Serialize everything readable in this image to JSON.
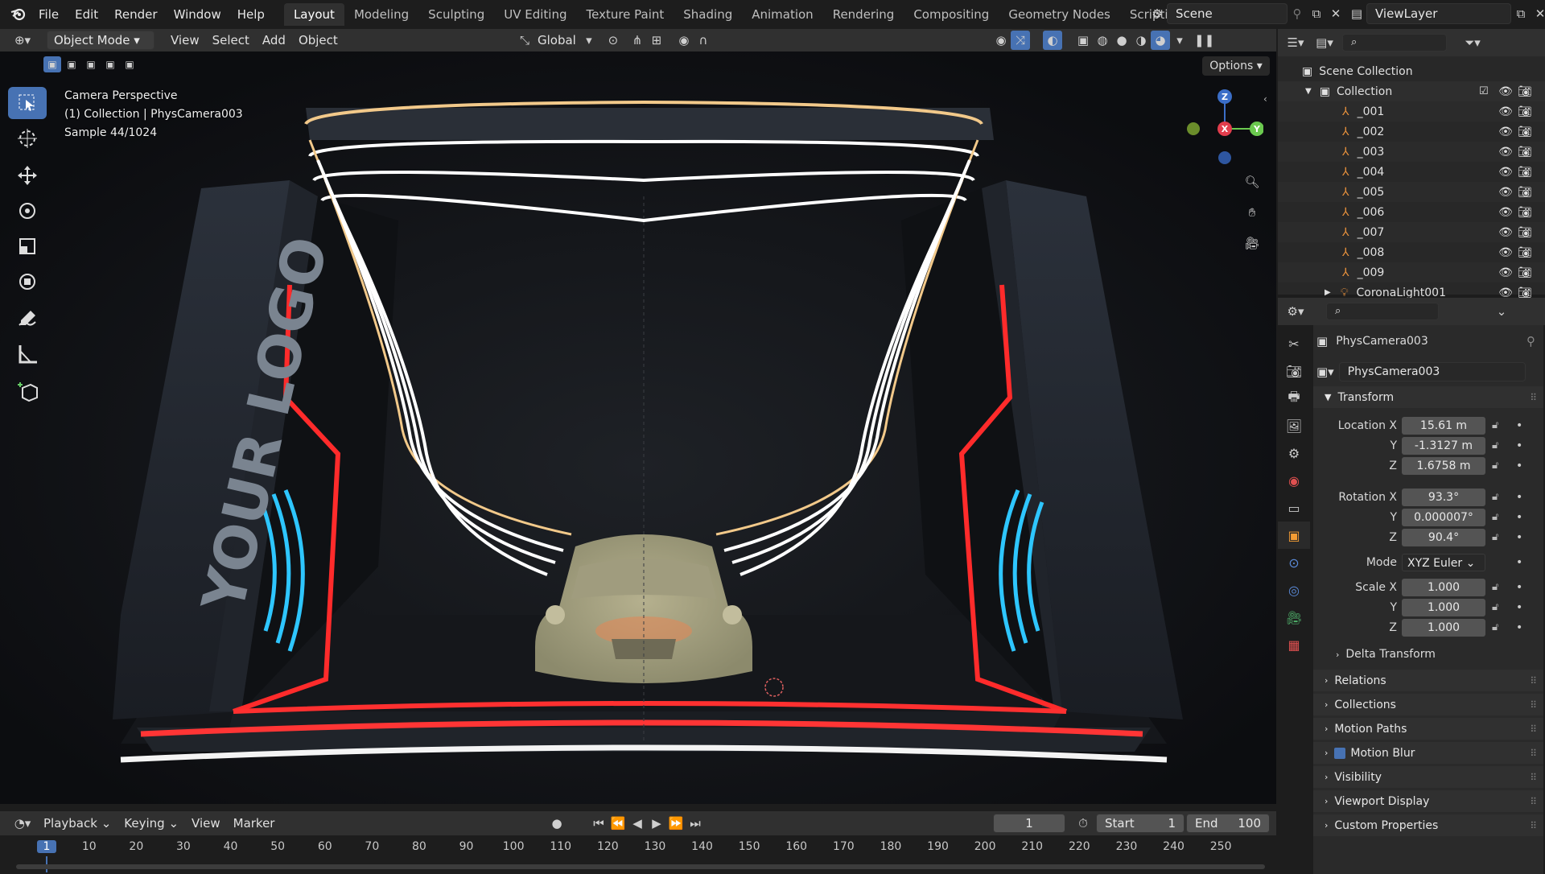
{
  "menu": [
    "File",
    "Edit",
    "Render",
    "Window",
    "Help"
  ],
  "workspaces": {
    "active": "Layout",
    "tabs": [
      "Layout",
      "Modeling",
      "Sculpting",
      "UV Editing",
      "Texture Paint",
      "Shading",
      "Animation",
      "Rendering",
      "Compositing",
      "Geometry Nodes",
      "Scripting"
    ]
  },
  "scene": {
    "name": "Scene",
    "view_layer": "ViewLayer"
  },
  "viewport_header": {
    "mode": "Object Mode",
    "items": [
      "View",
      "Select",
      "Add",
      "Object"
    ],
    "orientation": "Global",
    "options": "Options"
  },
  "viewport_overlay": {
    "line1": "Camera Perspective",
    "line2": "(1) Collection | PhysCamera003",
    "line3": "Sample 44/1024",
    "logo_text": "YOUR LOGO"
  },
  "gizmo": {
    "x": "X",
    "y": "Y",
    "z": "Z"
  },
  "outliner": {
    "root": "Scene Collection",
    "collection": "Collection",
    "items": [
      "_001",
      "_002",
      "_003",
      "_004",
      "_005",
      "_006",
      "_007",
      "_008",
      "_009",
      "CoronaLight001"
    ]
  },
  "properties": {
    "object_name": "PhysCamera003",
    "data_name": "PhysCamera003",
    "transform": {
      "title": "Transform",
      "location_label": "Location X",
      "location": [
        "15.61 m",
        "-1.3127 m",
        "1.6758 m"
      ],
      "rotation_label": "Rotation X",
      "rotation": [
        "93.3°",
        "0.000007°",
        "90.4°"
      ],
      "mode_label": "Mode",
      "mode": "XYZ Euler",
      "scale_label": "Scale X",
      "scale": [
        "1.000",
        "1.000",
        "1.000"
      ],
      "y": "Y",
      "z": "Z"
    },
    "delta": "Delta Transform",
    "sections": [
      "Relations",
      "Collections",
      "Motion Paths",
      "Motion Blur",
      "Visibility",
      "Viewport Display",
      "Custom Properties"
    ]
  },
  "timeline": {
    "menus": [
      "Playback",
      "Keying",
      "View",
      "Marker"
    ],
    "current_frame": "1",
    "start_label": "Start",
    "start": "1",
    "end_label": "End",
    "end": "100",
    "ticks": [
      "1",
      "10",
      "20",
      "30",
      "40",
      "50",
      "60",
      "70",
      "80",
      "90",
      "100",
      "110",
      "120",
      "130",
      "140",
      "150",
      "160",
      "170",
      "180",
      "190",
      "200",
      "210",
      "220",
      "230",
      "240",
      "250"
    ]
  }
}
